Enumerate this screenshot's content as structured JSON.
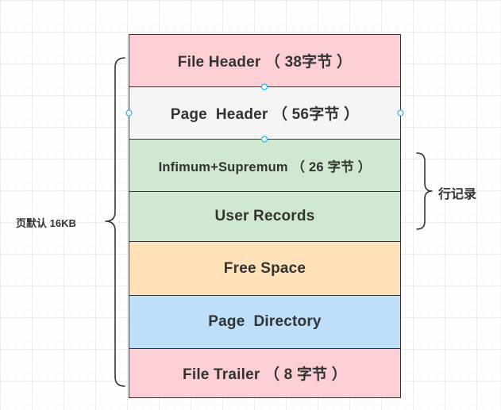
{
  "page_structure": {
    "blocks": [
      {
        "label": "File Header （ 38字节 ）",
        "fill": "#fbcfd4"
      },
      {
        "label": "Page  Header （ 56字节 ）",
        "fill": "#f5f5f5",
        "selected": true
      },
      {
        "label": "Infimum+Supremum （ 26 字节 ）",
        "fill": "#d0e8d0"
      },
      {
        "label": "User Records",
        "fill": "#d0e8d0"
      },
      {
        "label": "Free Space",
        "fill": "#ffe2b8"
      },
      {
        "label": "Page  Directory",
        "fill": "#bfdff9"
      },
      {
        "label": "File Trailer （ 8 字节 ）",
        "fill": "#fbcfd4"
      }
    ]
  },
  "annotations": {
    "left_brace_label": "页默认 16KB",
    "right_brace_label": "行记录"
  },
  "colors": {
    "stroke": "#333333",
    "selection_handle": "#29b6f2"
  }
}
